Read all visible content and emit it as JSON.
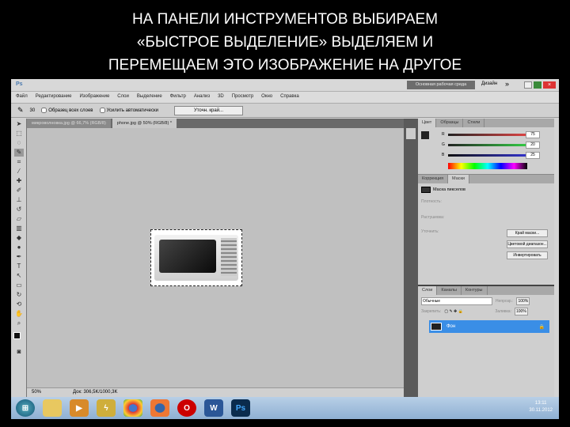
{
  "slide": {
    "title_lines": [
      "НА ПАНЕЛИ ИНСТРУМЕНТОВ ВЫБИРАЕМ",
      "«БЫСТРОЕ ВЫДЕЛЕНИЕ» ВЫДЕЛЯЕМ И",
      "ПЕРЕМЕЩАЕМ ЭТО ИЗОБРАЖЕНИЕ НА ДРУГОЕ"
    ]
  },
  "app": {
    "logo": "Ps",
    "workspace": "Основная рабочая среда",
    "design": "Дизайн",
    "more": "»"
  },
  "menu": [
    "Файл",
    "Редактирование",
    "Изображение",
    "Слои",
    "Выделение",
    "Фильтр",
    "Анализ",
    "3D",
    "Просмотр",
    "Окно",
    "Справка"
  ],
  "options": {
    "brush_size": "30",
    "sample_all": "Образец всех слоев",
    "auto_enhance": "Усилить автоматически",
    "refine_edge": "Уточн. край..."
  },
  "tabs": [
    "микроволновка.jpg @ 66,7% (RGB/8)",
    "phone.jpg @ 50% (RGB/8) *"
  ],
  "status": {
    "zoom": "50%",
    "doc": "Док: 306,5K/1000,3K"
  },
  "color_panel": {
    "tabs": [
      "Цвет",
      "Образцы",
      "Стили"
    ],
    "r": "75",
    "g": "20",
    "b": "25",
    "r_label": "R",
    "g_label": "G",
    "b_label": "B"
  },
  "mask_panel": {
    "tabs": [
      "Коррекция",
      "Маски"
    ],
    "title": "Маска пикселов",
    "density": "Плотность:",
    "feather": "Растушевка:",
    "refine": "Уточнить:",
    "buttons": [
      "Край маски...",
      "Цветовой диапазон...",
      "Инвертировать"
    ]
  },
  "layers_panel": {
    "tabs": [
      "Слои",
      "Каналы",
      "Контуры"
    ],
    "blend": "Обычные",
    "opacity_label": "Непрозр.:",
    "opacity": "100%",
    "lock_label": "Закрепить:",
    "fill_label": "Заливка:",
    "fill": "100%",
    "layer_name": "Фон"
  },
  "taskbar": {
    "icons": [
      "windows-start",
      "explorer",
      "media-player",
      "winamp",
      "chrome",
      "firefox",
      "opera",
      "word",
      "photoshop"
    ],
    "word": "W",
    "ps": "Ps",
    "time": "13:11",
    "date": "30.11.2012"
  }
}
